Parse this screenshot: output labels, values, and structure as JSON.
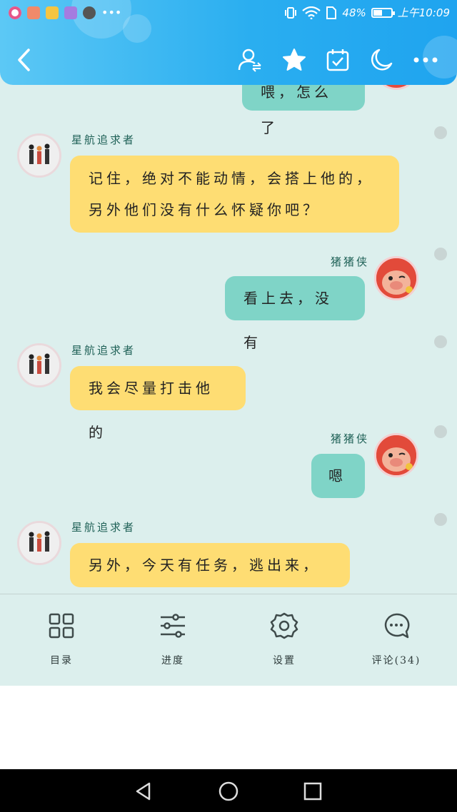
{
  "status": {
    "battery_percent": "48%",
    "battery_level": 0.48,
    "time": "上午10:09"
  },
  "header": {
    "icons": [
      "back-icon",
      "user-switch-icon",
      "star-icon",
      "calendar-check-icon",
      "moon-icon",
      "more-icon"
    ]
  },
  "chat": {
    "partial_top_message": "喂，怎么了",
    "messages": [
      {
        "side": "left",
        "name": "星航追求者",
        "lines": [
          "记住，绝对不能动情，会搭上他的，",
          "另外他们没有什么怀疑你吧？"
        ]
      },
      {
        "side": "right",
        "name": "猪猪侠",
        "lines": [
          "看上去，没有"
        ]
      },
      {
        "side": "left",
        "name": "星航追求者",
        "lines": [
          "我会尽量打击他的"
        ]
      },
      {
        "side": "right",
        "name": "猪猪侠",
        "lines": [
          "嗯"
        ]
      },
      {
        "side": "left",
        "name": "星航追求者",
        "lines": [
          "另外，今天有任务，逃出来，走"
        ]
      }
    ]
  },
  "nav": {
    "items": [
      {
        "label": "目录",
        "icon": "grid-icon"
      },
      {
        "label": "进度",
        "icon": "sliders-icon"
      },
      {
        "label": "设置",
        "icon": "gear-icon"
      },
      {
        "label": "评论(34)",
        "icon": "comment-icon"
      }
    ]
  },
  "colors": {
    "header": "#2aaef0",
    "chat_bg": "#dcefed",
    "bubble_left": "#fedd73",
    "bubble_right": "#7fd4c7"
  }
}
